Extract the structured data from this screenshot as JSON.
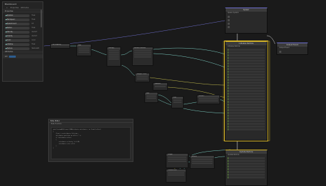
{
  "blackboard": {
    "title": "Blackboard",
    "add_label": "+",
    "toolbar_items": [
      "Properties",
      "Attributes"
    ],
    "section_properties": "Properties",
    "properties": [
      {
        "name": "Rotation",
        "type": "Float"
      },
      {
        "name": "MaxSpeed",
        "type": "Float"
      },
      {
        "name": "SpawnCount",
        "type": "Int"
      },
      {
        "name": "Radius",
        "type": "Float"
      },
      {
        "name": "Velocity",
        "type": "Vector3"
      },
      {
        "name": "Gravity",
        "type": "Vector3"
      },
      {
        "name": "Color",
        "type": "Color"
      },
      {
        "name": "Lifetime",
        "type": "Float"
      },
      {
        "name": "Texture",
        "type": "Texture2D"
      }
    ],
    "section_attributes": "Attributes",
    "attributes_filter": "All"
  },
  "spawn_context": {
    "title": "Spawn",
    "subtitle": "Spawn System"
  },
  "init_context": {
    "title": "Initialize Particle",
    "subtitle": "Initialize Particle"
  },
  "output_context": {
    "title": "Output Event",
    "subtitle": "Output Event"
  },
  "update_context": {
    "title": "Update Particle",
    "subtitle": "Update Particle"
  },
  "operator_nodes": [
    {
      "title": "Get Property"
    },
    {
      "title": "Add"
    },
    {
      "title": "Multiply"
    },
    {
      "title": "Random Number"
    },
    {
      "title": "Sample Curve"
    },
    {
      "title": "Subtract"
    },
    {
      "title": "Add"
    },
    {
      "title": "Sine"
    },
    {
      "title": "Vector3"
    },
    {
      "title": "Length"
    },
    {
      "title": "Custom HLSL"
    },
    {
      "title": "Branch"
    }
  ],
  "hlsl_editor": {
    "title": "HLSL Editor",
    "subtitle": "HLSL Function",
    "code_lines": [
      "void CustomHLSL(inout VFXAttributes attributes, in float3 offset)",
      "{",
      "    float t = attributes.lifetime;",
      "    attributes.position += offset * t;",
      "",
      "    if (attributes.alive)",
      "    {",
      "        attributes.velocity *= 0.98;",
      "        attributes.size = 0.5;",
      "    }",
      "}"
    ]
  },
  "bottom_group": {
    "title": "Output Particle"
  },
  "colors": {
    "accent": "#d4b328",
    "wire_float": "#7fd3c8",
    "wire_vec": "#c9c14f",
    "wire_flow": "#f2f2f2"
  }
}
